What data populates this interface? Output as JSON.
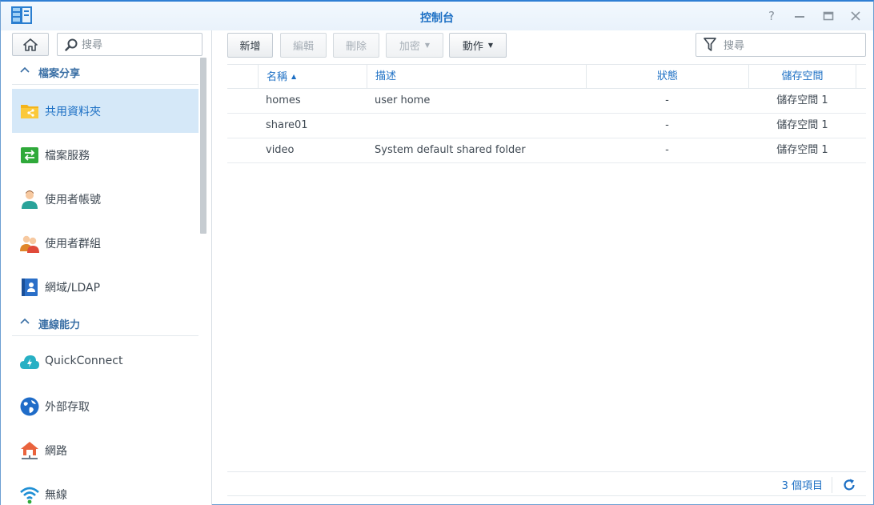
{
  "window": {
    "title": "控制台",
    "controls": [
      "help-icon",
      "minimize-icon",
      "maximize-icon",
      "close-icon"
    ]
  },
  "colors": {
    "accent": "#1c6fc4",
    "title_border": "#2f7fd4",
    "active_bg": "#d5e8f8"
  },
  "sidebar": {
    "search_placeholder": "搜尋",
    "groups": [
      {
        "label": "檔案分享"
      },
      {
        "label": "連線能力"
      }
    ],
    "items": [
      {
        "label": "共用資料夾",
        "icon": "shared-folder-icon",
        "active": true
      },
      {
        "label": "檔案服務",
        "icon": "file-services-icon"
      },
      {
        "label": "使用者帳號",
        "icon": "user-icon"
      },
      {
        "label": "使用者群組",
        "icon": "group-icon"
      },
      {
        "label": "網域/LDAP",
        "icon": "domain-ldap-icon"
      },
      {
        "label": "QuickConnect",
        "icon": "quickconnect-icon"
      },
      {
        "label": "外部存取",
        "icon": "external-access-icon"
      },
      {
        "label": "網路",
        "icon": "network-icon"
      },
      {
        "label": "無線",
        "icon": "wireless-icon"
      }
    ]
  },
  "toolbar": {
    "create": "新增",
    "edit": "編輯",
    "delete": "刪除",
    "encrypt": "加密",
    "action": "動作",
    "filter_placeholder": "搜尋"
  },
  "table": {
    "columns": [
      "名稱",
      "描述",
      "狀態",
      "儲存空間"
    ],
    "rows": [
      {
        "name": "homes",
        "desc": "user home",
        "status": "-",
        "volume": "儲存空間 1"
      },
      {
        "name": "share01",
        "desc": "",
        "status": "-",
        "volume": "儲存空間 1"
      },
      {
        "name": "video",
        "desc": "System default shared folder",
        "status": "-",
        "volume": "儲存空間 1"
      }
    ]
  },
  "footer": {
    "count": "3 個項目"
  }
}
